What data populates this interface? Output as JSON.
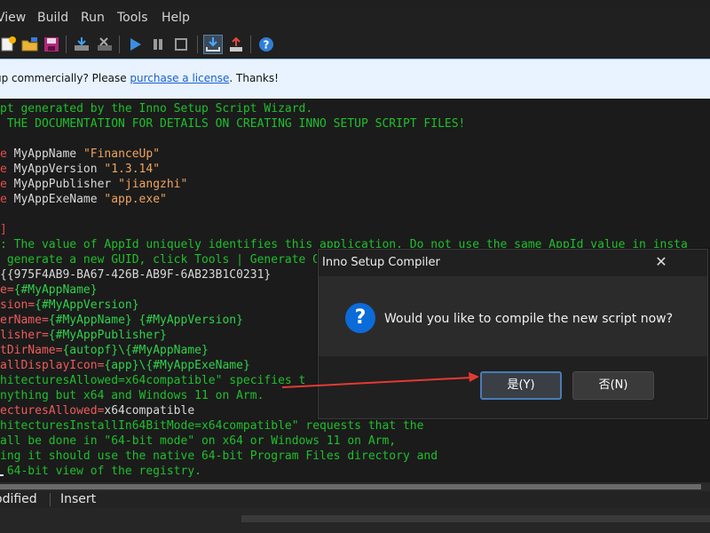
{
  "menu": [
    "View",
    "Build",
    "Run",
    "Tools",
    "Help"
  ],
  "toolbar_icons": [
    "new-file-icon",
    "open-folder-icon",
    "save-icon",
    "compile-icon",
    "stop-compile-icon",
    "run-icon",
    "pause-icon",
    "stop-icon",
    "download-icon",
    "upload-icon",
    "help-icon"
  ],
  "banner": {
    "prefix": "up commercially? Please ",
    "link": "purchase a license",
    "suffix": ". Thanks!"
  },
  "code": [
    [
      [
        "c-cmt",
        "pt generated by the Inno Setup Script Wizard."
      ]
    ],
    [
      [
        "c-cmt",
        " THE DOCUMENTATION FOR DETAILS ON CREATING INNO SETUP SCRIPT FILES!"
      ]
    ],
    [
      [
        "c-id",
        ""
      ]
    ],
    [
      [
        "c-kw",
        "e "
      ],
      [
        "c-id",
        "MyAppName "
      ],
      [
        "c-str",
        "\"FinanceUp\""
      ]
    ],
    [
      [
        "c-kw",
        "e "
      ],
      [
        "c-id",
        "MyAppVersion "
      ],
      [
        "c-str",
        "\"1.3.14\""
      ]
    ],
    [
      [
        "c-kw",
        "e "
      ],
      [
        "c-id",
        "MyAppPublisher "
      ],
      [
        "c-str",
        "\"jiangzhi\""
      ]
    ],
    [
      [
        "c-kw",
        "e "
      ],
      [
        "c-id",
        "MyAppExeName "
      ],
      [
        "c-str",
        "\"app.exe\""
      ]
    ],
    [
      [
        "c-id",
        ""
      ]
    ],
    [
      [
        "c-kw",
        "]"
      ]
    ],
    [
      [
        "c-cmt",
        ": The value of AppId uniquely identifies this application. Do not use the same AppId value in insta"
      ]
    ],
    [
      [
        "c-cmt",
        " generate a new GUID, click Tools | Generate GUID"
      ]
    ],
    [
      [
        "c-id",
        "{{975F4AB9-BA67-426B-AB9F-6AB23B1C0231}"
      ]
    ],
    [
      [
        "c-const",
        "e="
      ],
      [
        "c-grn",
        "{#MyAppName}"
      ]
    ],
    [
      [
        "c-const",
        "sion="
      ],
      [
        "c-grn",
        "{#MyAppVersion}"
      ]
    ],
    [
      [
        "c-const",
        "erName="
      ],
      [
        "c-grn",
        "{#MyAppName} {#MyAppVersion}"
      ]
    ],
    [
      [
        "c-const",
        "lisher="
      ],
      [
        "c-grn",
        "{#MyAppPublisher}"
      ]
    ],
    [
      [
        "c-const",
        "tDirName="
      ],
      [
        "c-grn",
        "{autopf}\\{#MyAppName}"
      ]
    ],
    [
      [
        "c-const",
        "allDisplayIcon="
      ],
      [
        "c-grn",
        "{app}\\{#MyAppExeName}"
      ]
    ],
    [
      [
        "c-cmt",
        "hitecturesAllowed=x64compatible\" specifies t"
      ]
    ],
    [
      [
        "c-cmt",
        "nything but x64 and Windows 11 on Arm."
      ]
    ],
    [
      [
        "c-const",
        "ecturesAllowed="
      ],
      [
        "c-id",
        "x64compatible"
      ]
    ],
    [
      [
        "c-cmt",
        "hitecturesInstallIn64BitMode=x64compatible\" requests that the"
      ]
    ],
    [
      [
        "c-cmt",
        "all be done in \"64-bit mode\" on x64 or Windows 11 on Arm,"
      ]
    ],
    [
      [
        "c-cmt",
        "ing it should use the native 64-bit Program Files directory and"
      ]
    ],
    [
      [
        "c-cmt",
        " 64-bit view of the registry."
      ]
    ]
  ],
  "status": {
    "modified": "odified",
    "mode": "Insert"
  },
  "dialog": {
    "title": "Inno Setup Compiler",
    "close_glyph": "✕",
    "icon_glyph": "?",
    "message": "Would you like to compile the new script now?",
    "yes_label": "是(Y)",
    "no_label": "否(N)"
  },
  "colors": {
    "accent": "#0b6bd8",
    "annotation_arrow": "#e53935"
  }
}
